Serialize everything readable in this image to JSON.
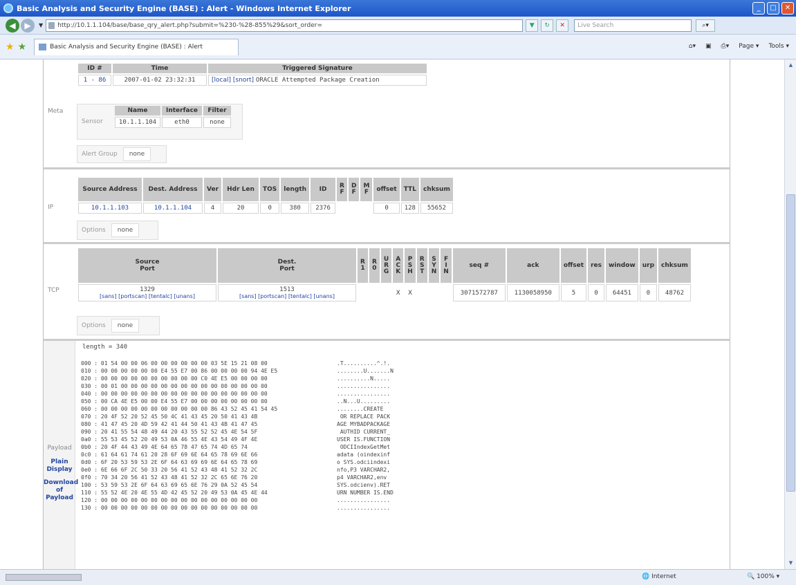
{
  "window": {
    "title": "Basic Analysis and Security Engine (BASE) : Alert - Windows Internet Explorer"
  },
  "addressbar": {
    "url": "http://10.1.1.104/base/base_qry_alert.php?submit=%230-%28-855%29&sort_order=",
    "search_placeholder": "Live Search"
  },
  "tab": {
    "label": "Basic Analysis and Security Engine (BASE) : Alert"
  },
  "toolbar": {
    "page_label": "Page",
    "tools_label": "Tools"
  },
  "meta": {
    "label": "Meta",
    "headers": [
      "ID #",
      "Time",
      "Triggered Signature"
    ],
    "row": {
      "id": "1 - 86",
      "time": "2007-01-02 23:32:31",
      "sig_links": [
        "[local]",
        "[snort]"
      ],
      "signature": "ORACLE Attempted Package Creation"
    },
    "sensor_label": "Sensor",
    "sensor_headers": [
      "Name",
      "Interface",
      "Filter"
    ],
    "sensor_row": [
      "10.1.1.104",
      "eth0",
      "none"
    ],
    "alert_group_label": "Alert Group",
    "alert_group_value": "none"
  },
  "ip": {
    "label": "IP",
    "headers": [
      "Source Address",
      "Dest. Address",
      "Ver",
      "Hdr Len",
      "TOS",
      "length",
      "ID",
      "R\nF",
      "D\nF",
      "M\nF",
      "offset",
      "TTL",
      "chksum"
    ],
    "row": [
      "10.1.1.103",
      "10.1.1.104",
      "4",
      "20",
      "0",
      "380",
      "2376",
      "",
      "",
      "",
      "0",
      "128",
      "55652"
    ],
    "options_label": "Options",
    "options_value": "none"
  },
  "tcp": {
    "label": "TCP",
    "src_header": "Source\nPort",
    "dst_header": "Dest.\nPort",
    "flag_headers": [
      "R\n1",
      "R\n0",
      "U\nR\nG",
      "A\nC\nK",
      "P\nS\nH",
      "R\nS\nT",
      "S\nY\nN",
      "F\nI\nN"
    ],
    "other_headers": [
      "seq #",
      "ack",
      "offset",
      "res",
      "window",
      "urp",
      "chksum"
    ],
    "src_port": "1329",
    "dst_port": "1513",
    "src_links": "[sans] [portscan] [tentalc] [unans]",
    "dst_links": "[sans] [portscan] [tentalc] [unans]",
    "flags": [
      "",
      "",
      "",
      "X",
      "X",
      "",
      "",
      ""
    ],
    "other_values": [
      "3071572787",
      "1130058950",
      "5",
      "0",
      "64451",
      "0",
      "48762"
    ],
    "options_label": "Options",
    "options_value": "none"
  },
  "payload": {
    "label": "Payload",
    "plain_display": "Plain\nDisplay",
    "download": "Download\nof\nPayload",
    "length_line": "length = 340",
    "hex_lines": [
      "000 : 01 54 00 00 06 00 00 00 00 00 00 03 5E 15 21 08 00",
      "010 : 00 00 00 00 00 00 E4 55 E7 00 86 00 00 00 00 94 4E E5",
      "020 : 00 00 00 00 00 00 00 00 00 00 C0 4E E5 00 00 00 00",
      "030 : 00 01 00 00 00 00 00 00 00 00 00 00 00 00 00 00 00",
      "040 : 00 00 00 00 00 00 00 00 00 00 00 00 00 00 00 00 00",
      "050 : 00 CA 4E E5 00 00 E4 55 E7 00 00 00 00 00 00 00 00",
      "060 : 00 00 00 00 00 00 00 00 00 00 00 86 43 52 45 41 54 45",
      "070 : 20 4F 52 20 52 45 50 4C 41 43 45 20 50 41 43 4B",
      "080 : 41 47 45 20 4D 59 42 41 44 50 41 43 4B 41 47 45",
      "090 : 20 41 55 54 48 49 44 20 43 55 52 52 45 4E 54 5F",
      "0a0 : 55 53 45 52 20 49 53 0A 46 55 4E 43 54 49 4F 4E",
      "0b0 : 20 4F 44 43 49 4E 64 65 78 47 65 74 4D 65 74",
      "0c0 : 61 64 61 74 61 20 28 6F 69 6E 64 65 78 69 6E 66",
      "0d0 : 6F 20 53 59 53 2E 6F 64 63 69 69 6E 64 65 78 69",
      "0e0 : 6E 66 6F 2C 50 33 20 56 41 52 43 48 41 52 32 2C",
      "0f0 : 70 34 20 56 41 52 43 48 41 52 32 2C 65 6E 76 20",
      "100 : 53 59 53 2E 6F 64 63 69 65 6E 76 29 0A 52 45 54",
      "110 : 55 52 4E 20 4E 55 4D 42 45 52 20 49 53 0A 45 4E 44",
      "120 : 00 00 00 00 00 00 00 00 00 00 00 00 00 00 00 00",
      "130 : 00 00 00 00 00 00 00 00 00 00 00 00 00 00 00 00"
    ],
    "ascii_lines": [
      ".T..........^.!.",
      "........U.......N",
      "..........N.....",
      "................",
      "................",
      "..N...U.........",
      "........CREATE",
      " OR REPLACE PACK",
      "AGE MYBADPACKAGE",
      " AUTHID CURRENT_",
      "USER IS.FUNCTION",
      " ODCIIndexGetMet",
      "adata (oindexinf",
      "o SYS.odciindexi",
      "nfo,P3 VARCHAR2,",
      "p4 VARCHAR2,env ",
      "SYS.odcienv).RET",
      "URN NUMBER IS.END",
      "................",
      "................"
    ]
  },
  "status": {
    "zone": "Internet",
    "zoom": "100%"
  }
}
